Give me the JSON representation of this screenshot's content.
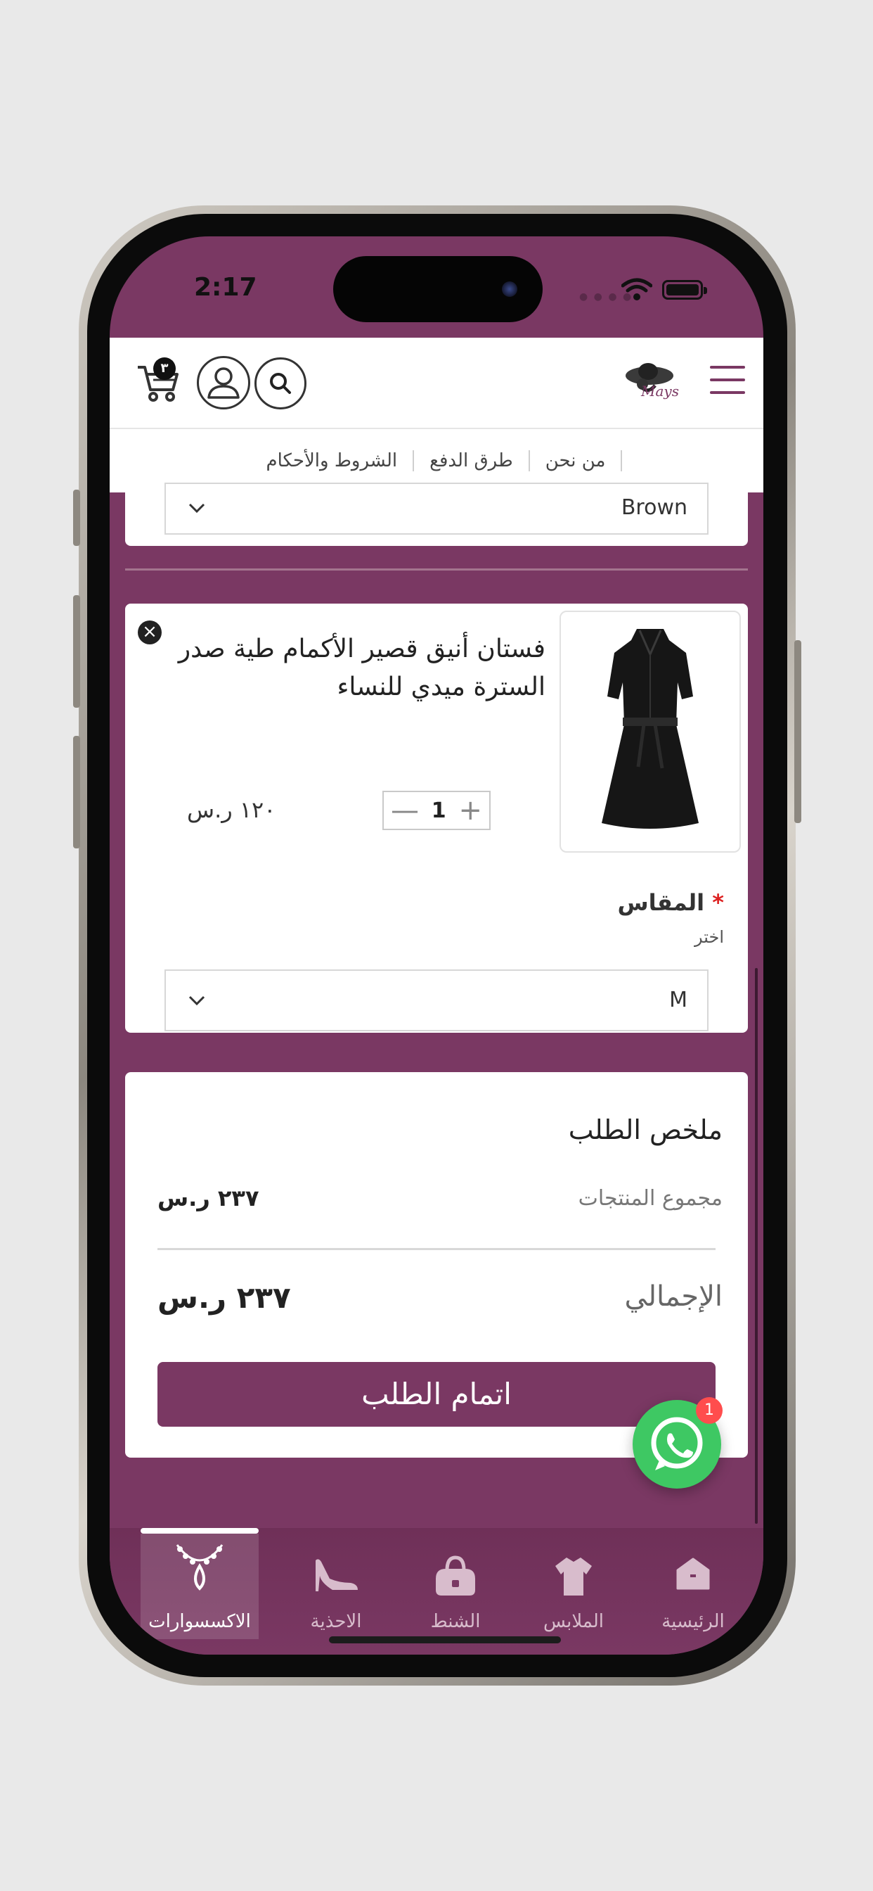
{
  "status": {
    "time": "2:17"
  },
  "header": {
    "logo_text": "Mays",
    "cart_count": "٣"
  },
  "nav_links": [
    "من نحن",
    "طرق الدفع",
    "الشروط والأحكام"
  ],
  "first_item": {
    "color_value": "Brown"
  },
  "product": {
    "title": "فستان أنيق قصير الأكمام طية صدر السترة ميدي للنساء",
    "price": "١٢٠ ر.س",
    "quantity": "1",
    "remove_glyph": "×",
    "minus_glyph": "—",
    "plus_glyph": "+",
    "size_label": "المقاس",
    "required_mark": "*",
    "size_hint": "اختر",
    "size_value": "M"
  },
  "summary": {
    "title": "ملخص الطلب",
    "subtotal_label": "مجموع المنتجات",
    "subtotal_value": "٢٣٧ ر.س",
    "total_label": "الإجمالي",
    "total_value": "٢٣٧ ر.س",
    "checkout_label": "اتمام الطلب"
  },
  "whatsapp": {
    "badge": "1"
  },
  "bottom_nav": [
    {
      "label": "الرئيسية",
      "icon": "home-icon"
    },
    {
      "label": "الملابس",
      "icon": "shirt-icon"
    },
    {
      "label": "الشنط",
      "icon": "bag-icon"
    },
    {
      "label": "الاحذية",
      "icon": "heel-icon"
    },
    {
      "label": "الاكسسوارات",
      "icon": "necklace-icon",
      "active": true
    }
  ],
  "colors": {
    "brand": "#7a3863",
    "whatsapp": "#3ec863",
    "badge": "#ff4d4d"
  }
}
